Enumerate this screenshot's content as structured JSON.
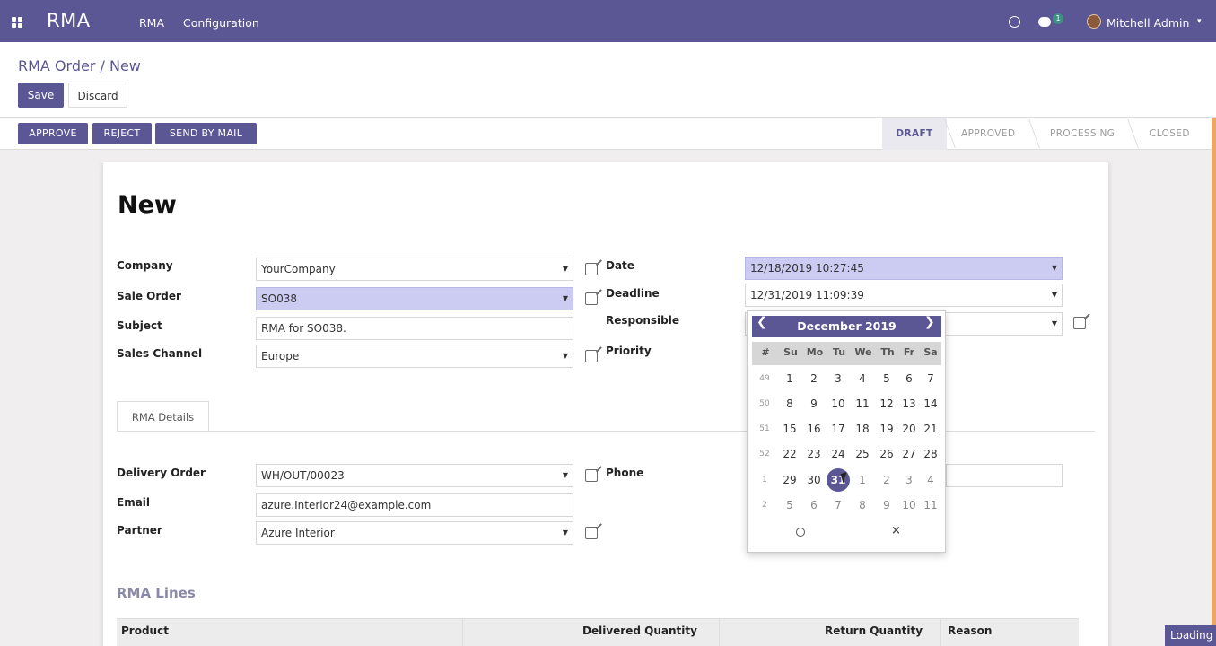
{
  "navbar": {
    "brand": "RMA",
    "menu": [
      "RMA",
      "Configuration"
    ],
    "chat_badge": "1",
    "user": "Mitchell Admin"
  },
  "control_panel": {
    "breadcrumb": "RMA Order / New",
    "save_label": "Save",
    "discard_label": "Discard"
  },
  "status_bar": {
    "buttons": [
      "APPROVE",
      "REJECT",
      "SEND BY MAIL"
    ],
    "stages": [
      "DRAFT",
      "APPROVED",
      "PROCESSING",
      "CLOSED"
    ],
    "active_stage": "DRAFT"
  },
  "form": {
    "title": "New",
    "left": [
      {
        "label": "Company",
        "value": "YourCompany"
      },
      {
        "label": "Sale Order",
        "value": "SO038"
      },
      {
        "label": "Subject",
        "value": "RMA for SO038."
      },
      {
        "label": "Sales Channel",
        "value": "Europe"
      }
    ],
    "right": [
      {
        "label": "Date",
        "value": "12/18/2019 10:27:45"
      },
      {
        "label": "Deadline",
        "value": "12/31/2019 11:09:39"
      },
      {
        "label": "Responsible",
        "value": ""
      },
      {
        "label": "Priority",
        "value": ""
      }
    ],
    "tab": "RMA Details",
    "details": [
      {
        "label": "Delivery Order",
        "value": "WH/OUT/00023"
      },
      {
        "label": "Email",
        "value": "azure.Interior24@example.com"
      },
      {
        "label": "Partner",
        "value": "Azure Interior"
      }
    ],
    "phone_label": "Phone",
    "lines_title": "RMA Lines",
    "lines_columns": [
      "Product",
      "Delivered Quantity",
      "Return Quantity",
      "Reason"
    ]
  },
  "datepicker": {
    "month": "December 2019",
    "dow": [
      "#",
      "Su",
      "Mo",
      "Tu",
      "We",
      "Th",
      "Fr",
      "Sa"
    ],
    "weeks": [
      [
        "49",
        "1",
        "2",
        "3",
        "4",
        "5",
        "6",
        "7"
      ],
      [
        "50",
        "8",
        "9",
        "10",
        "11",
        "12",
        "13",
        "14"
      ],
      [
        "51",
        "15",
        "16",
        "17",
        "18",
        "19",
        "20",
        "21"
      ],
      [
        "52",
        "22",
        "23",
        "24",
        "25",
        "26",
        "27",
        "28"
      ],
      [
        "1",
        "29",
        "30",
        "31",
        "1",
        "2",
        "3",
        "4"
      ],
      [
        "2",
        "5",
        "6",
        "7",
        "8",
        "9",
        "10",
        "11"
      ]
    ],
    "selected": "31",
    "close_symbol": "×"
  },
  "loading_label": "Loading"
}
